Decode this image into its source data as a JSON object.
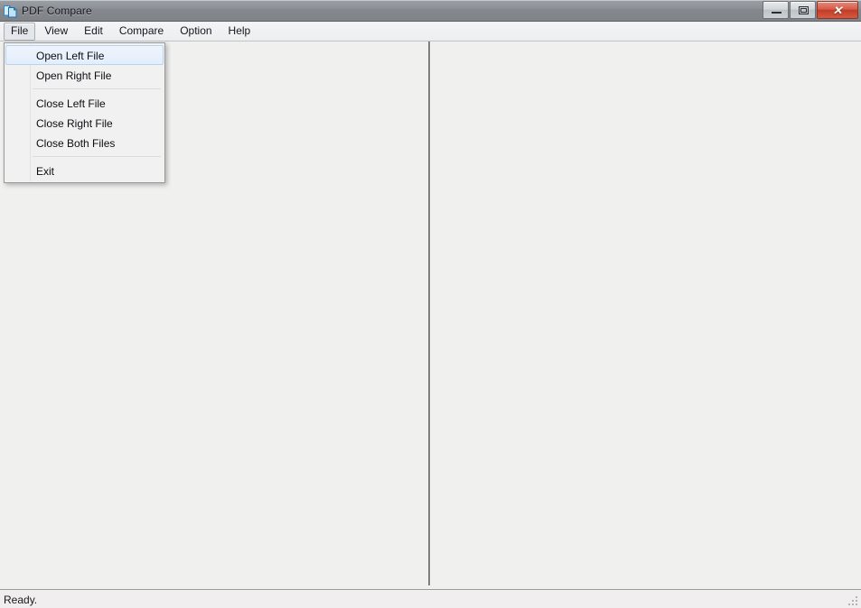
{
  "window": {
    "title": "PDF Compare",
    "icon": "pdf-compare-documents-icon",
    "controls": {
      "minimize_label": "",
      "maximize_label": "",
      "close_label": "✕"
    }
  },
  "menubar": {
    "items": [
      {
        "label": "File",
        "open": true
      },
      {
        "label": "View",
        "open": false
      },
      {
        "label": "Edit",
        "open": false
      },
      {
        "label": "Compare",
        "open": false
      },
      {
        "label": "Option",
        "open": false
      },
      {
        "label": "Help",
        "open": false
      }
    ]
  },
  "file_menu": {
    "groups": [
      {
        "items": [
          {
            "label": "Open Left File",
            "highlight": true
          },
          {
            "label": "Open Right File",
            "highlight": false
          }
        ]
      },
      {
        "items": [
          {
            "label": "Close Left File",
            "highlight": false
          },
          {
            "label": "Close Right File",
            "highlight": false
          },
          {
            "label": "Close Both Files",
            "highlight": false
          }
        ]
      },
      {
        "items": [
          {
            "label": "Exit",
            "highlight": false
          }
        ]
      }
    ]
  },
  "panes": {
    "left": {
      "content": ""
    },
    "right": {
      "content": ""
    }
  },
  "statusbar": {
    "text": "Ready."
  },
  "colors": {
    "titlebar_gradient_top": "#9ba0a6",
    "titlebar_gradient_bottom": "#808488",
    "close_button": "#c23a26",
    "menu_highlight_fill": "#e3eefb",
    "menu_highlight_border": "#b9d4ef",
    "pane_background": "#f0f0ef",
    "divider": "#808080"
  }
}
